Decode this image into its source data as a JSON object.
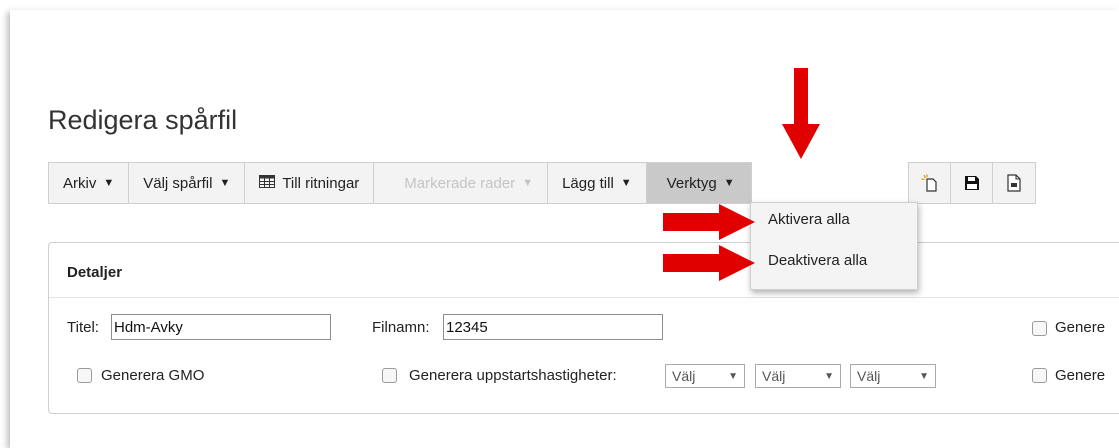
{
  "page": {
    "title": "Redigera spårfil"
  },
  "toolbar": {
    "arkiv": "Arkiv",
    "valj_sparfil": "Välj spårfil",
    "till_ritningar": "Till ritningar",
    "markerade_rader": "Markerade rader",
    "lagg_till": "Lägg till",
    "verktyg": "Verktyg",
    "caret": "▼"
  },
  "icons": {
    "new": "new-file-icon",
    "save": "save-icon",
    "export": "document-icon",
    "grid": "grid-icon"
  },
  "dropdown": {
    "items": [
      "Aktivera alla",
      "Deaktivera alla"
    ]
  },
  "details": {
    "heading": "Detaljer",
    "titel_label": "Titel:",
    "titel_value": "Hdm-Avky",
    "filnamn_label": "Filnamn:",
    "filnamn_value": "12345",
    "generera_gmo": "Generera GMO",
    "generera_uppstart": "Generera uppstartshastigheter:",
    "valj": "Välj",
    "genere_right_1": "Genere",
    "genere_right_2": "Genere"
  },
  "colors": {
    "annotation_arrow": "#e00000",
    "active_menu": "#c9c9c9"
  }
}
